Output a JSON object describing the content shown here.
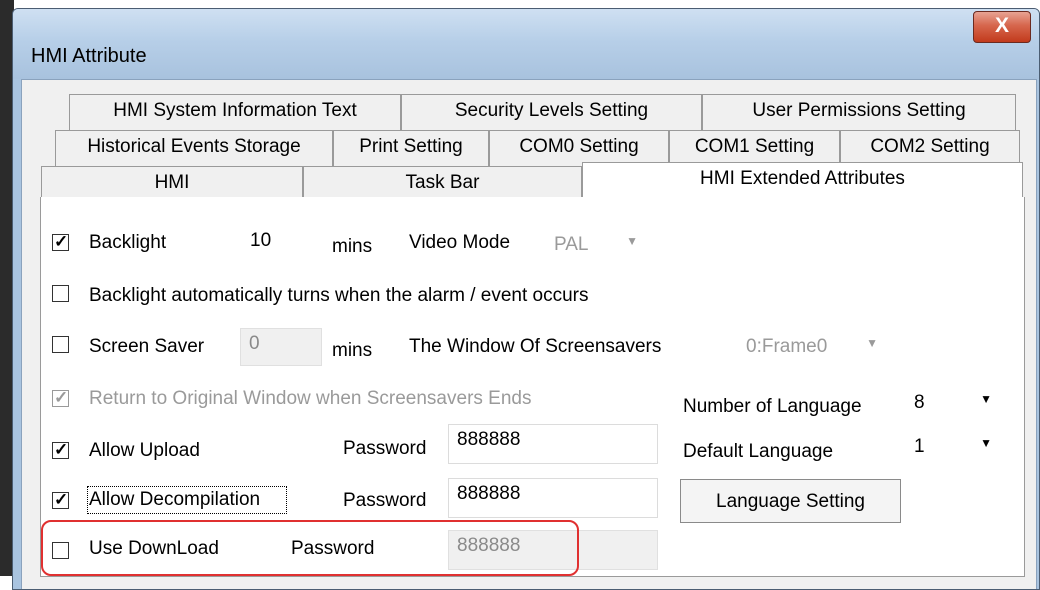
{
  "window": {
    "title": "HMI Attribute",
    "close_label": "X"
  },
  "tabs": {
    "row1": [
      "HMI System Information Text",
      "Security Levels Setting",
      "User Permissions Setting"
    ],
    "row2": [
      "Historical Events Storage",
      "Print Setting",
      "COM0 Setting",
      "COM1 Setting",
      "COM2 Setting"
    ],
    "row3": [
      "HMI",
      "Task Bar",
      "HMI Extended Attributes"
    ],
    "selected": "HMI Extended Attributes"
  },
  "backlight": {
    "label": "Backlight",
    "checked": true,
    "value": "10",
    "unit": "mins",
    "video_mode_label": "Video Mode",
    "video_mode_value": "PAL"
  },
  "backlight_alarm": {
    "label": "Backlight automatically turns when the alarm / event occurs",
    "checked": false
  },
  "screen_saver": {
    "label": "Screen Saver",
    "checked": false,
    "value": "0",
    "unit": "mins",
    "window_label": "The Window Of Screensavers",
    "window_value": "0:Frame0"
  },
  "return_original": {
    "label": "Return to Original Window when Screensavers Ends",
    "checked": true,
    "disabled": true
  },
  "language": {
    "number_label": "Number of Language",
    "number_value": "8",
    "default_label": "Default Language",
    "default_value": "1",
    "setting_button": "Language Setting"
  },
  "allow_upload": {
    "label": "Allow Upload",
    "checked": true,
    "password_label": "Password",
    "password": "888888"
  },
  "allow_decompilation": {
    "label": "Allow Decompilation",
    "checked": true,
    "password_label": "Password",
    "password": "888888"
  },
  "use_download": {
    "label": "Use DownLoad",
    "checked": false,
    "password_label": "Password",
    "password": "888888"
  },
  "icons": {
    "checkmark": "checkmark-icon",
    "dropdown": "chevron-down-icon",
    "close": "close-icon"
  },
  "colors": {
    "highlight": "#e03030",
    "title_bar": "#b7cfe8",
    "close_button": "#c23a1c"
  }
}
